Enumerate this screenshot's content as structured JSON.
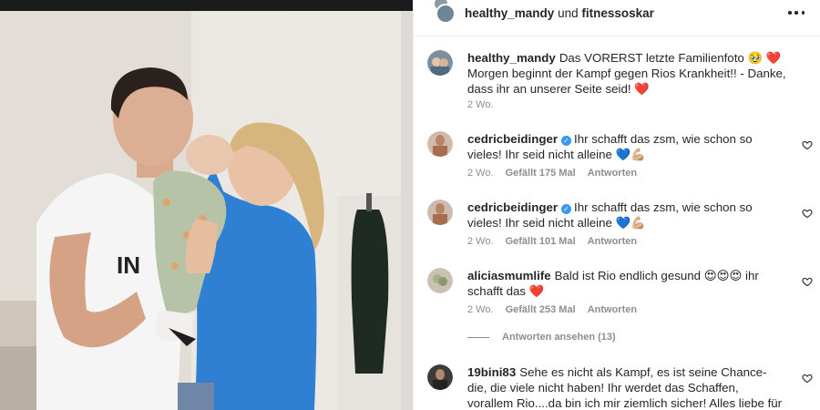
{
  "header": {
    "owner": "healthy_mandy",
    "connector": "und",
    "collaborator": "fitnessoskar"
  },
  "comments": [
    {
      "user": "healthy_mandy",
      "text": "Das VORERST letzte Familienfoto 🥹 ❤️ Morgen beginnt der Kampf gegen Rios Krankheit!! - Danke, dass ihr an unserer Seite seid! ❤️",
      "time": "2 Wo."
    },
    {
      "user": "cedricbeidinger",
      "verified": "✓",
      "text": "Ihr schafft das zsm, wie schon so vieles! Ihr seid nicht alleine 💙💪🏼",
      "time": "2 Wo.",
      "likes": "Gefällt 175 Mal",
      "reply": "Antworten"
    },
    {
      "user": "cedricbeidinger",
      "verified": "✓",
      "text": "Ihr schafft das zsm, wie schon so vieles! Ihr seid nicht alleine 💙💪🏼",
      "time": "2 Wo.",
      "likes": "Gefällt 101 Mal",
      "reply": "Antworten"
    },
    {
      "user": "aliciasmumlife",
      "text": "Bald ist Rio endlich gesund 😍😍😍 ihr schafft das ❤️",
      "time": "2 Wo.",
      "likes": "Gefällt 253 Mal",
      "reply": "Antworten"
    },
    {
      "user": "19bini83",
      "text": "Sehe es nicht als Kampf, es ist seine Chance- die, die viele nicht haben! Ihr werdet das Schaffen, vorallem Rio....da bin ich mir ziemlich sicher! Alles liebe für euch und"
    }
  ],
  "view_replies": "Antworten ansehen (13)",
  "icons": {
    "more": "more-options-icon",
    "like": "heart-outline-icon"
  },
  "colors": {
    "text": "#262626",
    "secondary": "#8e8e8e",
    "verified": "#3897f0",
    "sweater": "#2f7fd3"
  }
}
